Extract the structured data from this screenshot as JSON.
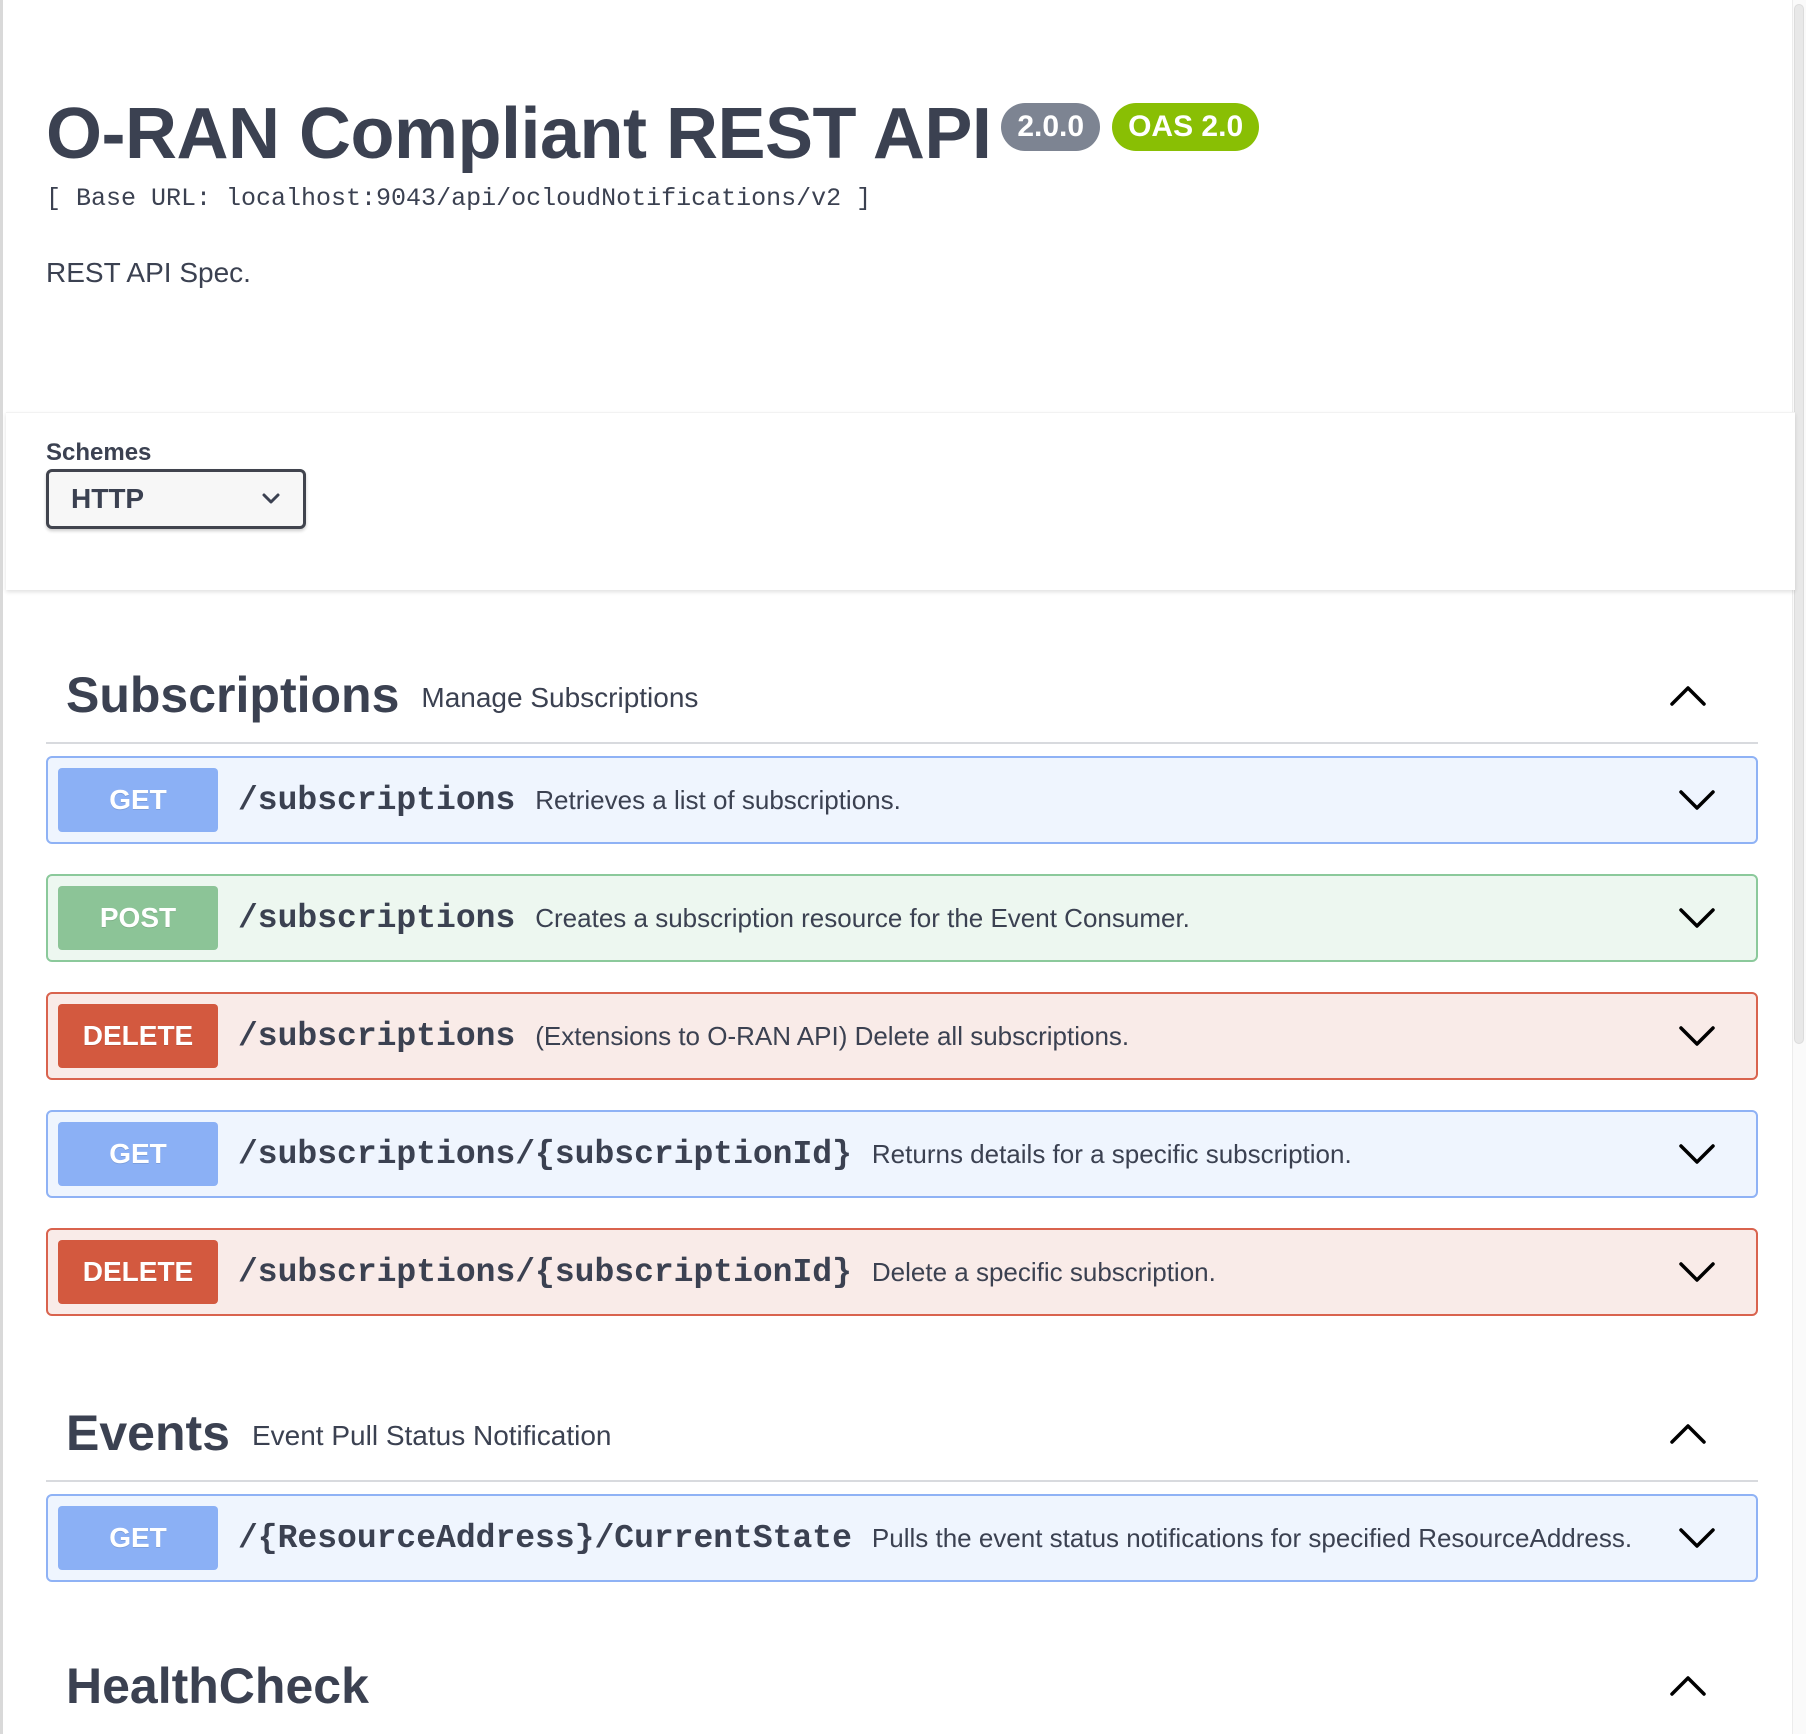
{
  "info": {
    "title": "O-RAN Compliant REST API",
    "version": "2.0.0",
    "oas": "OAS 2.0",
    "base_url": "[ Base URL: localhost:9043/api/ocloudNotifications/v2 ]",
    "description": "REST API Spec."
  },
  "schemes": {
    "label": "Schemes",
    "selected": "HTTP"
  },
  "tags": [
    {
      "name": "Subscriptions",
      "description": "Manage Subscriptions",
      "operations": [
        {
          "method": "GET",
          "path": "/subscriptions",
          "summary": "Retrieves a list of subscriptions."
        },
        {
          "method": "POST",
          "path": "/subscriptions",
          "summary": "Creates a subscription resource for the Event Consumer."
        },
        {
          "method": "DELETE",
          "path": "/subscriptions",
          "summary": "(Extensions to O-RAN API) Delete all subscriptions."
        },
        {
          "method": "GET",
          "path": "/subscriptions/{subscriptionId}",
          "summary": "Returns details for a specific subscription."
        },
        {
          "method": "DELETE",
          "path": "/subscriptions/{subscriptionId}",
          "summary": "Delete a specific subscription."
        }
      ]
    },
    {
      "name": "Events",
      "description": "Event Pull Status Notification",
      "operations": [
        {
          "method": "GET",
          "path": "/{ResourceAddress}/CurrentState",
          "summary": "Pulls the event status notifications for specified ResourceAddress."
        }
      ]
    },
    {
      "name": "HealthCheck",
      "description": "",
      "operations": []
    }
  ],
  "colors": {
    "get": "#8bb0f5",
    "post": "#8cc497",
    "delete": "#d3593f",
    "version_badge": "#7d8492",
    "oas_badge": "#89bf04"
  },
  "icons": {
    "tag_toggle": "chevron-up-icon",
    "op_toggle": "chevron-down-icon",
    "select_arrow": "chevron-down-icon"
  }
}
